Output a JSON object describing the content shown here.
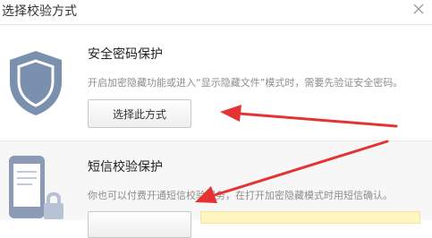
{
  "dialog": {
    "title": "选择校验方式",
    "close_icon": "close-icon"
  },
  "options": [
    {
      "icon": "shield-icon",
      "title": "安全密码保护",
      "description": "开启加密隐藏功能或进入“显示隐藏文件”模式时，需要先验证安全密码。",
      "button_label": "选择此方式"
    },
    {
      "icon": "phone-lock-icon",
      "title": "短信校验保护",
      "description": "你也可以付费开通短信校验服务，在打开加密隐藏模式时用短信确认。",
      "button_label": ""
    }
  ],
  "colors": {
    "accent": "#e53333",
    "shield": "#7b8fae",
    "notice": "#fdf6c3"
  }
}
